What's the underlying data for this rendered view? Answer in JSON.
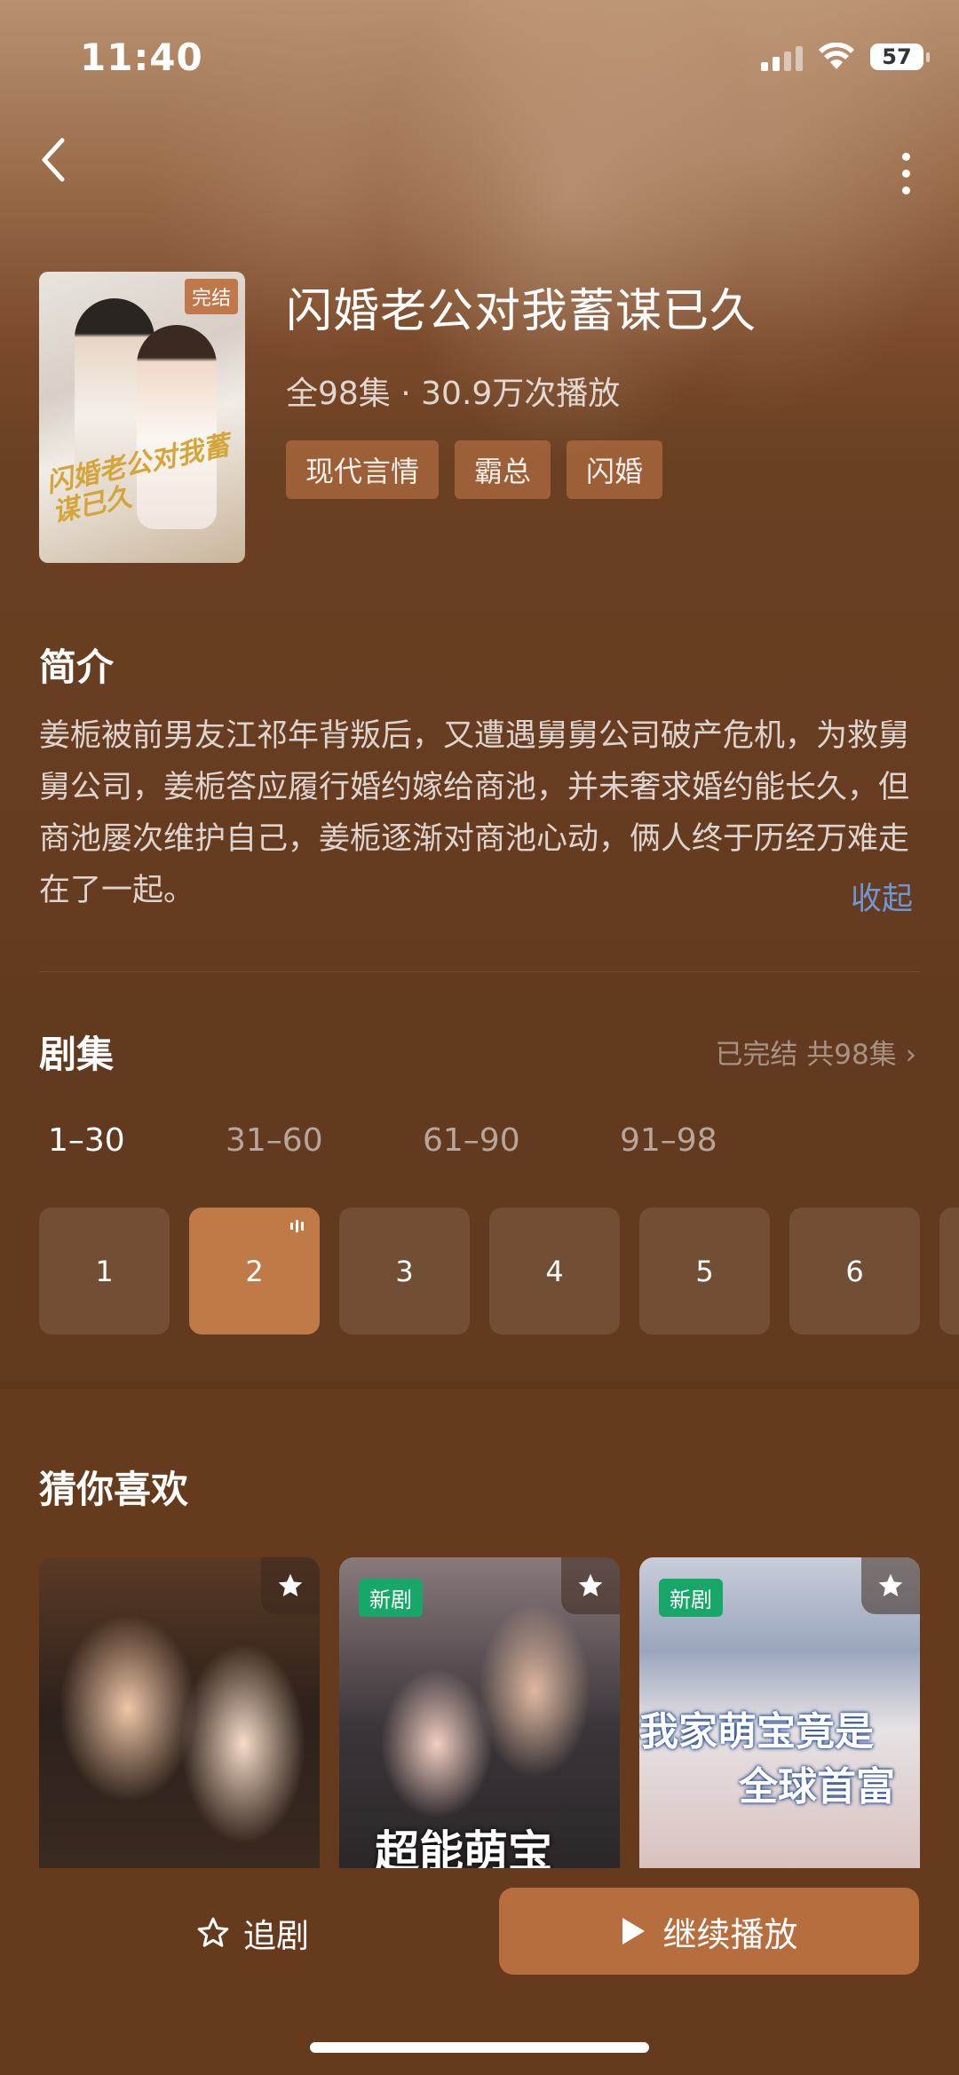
{
  "status_bar": {
    "time": "11:40",
    "battery": "57"
  },
  "drama": {
    "status_badge": "完结",
    "poster_text": "闪婚老公对我蓄谋已久",
    "title": "闪婚老公对我蓄谋已久",
    "meta": "全98集 · 30.9万次播放",
    "tags": [
      "现代言情",
      "霸总",
      "闪婚"
    ]
  },
  "intro": {
    "heading": "简介",
    "text": "姜栀被前男友江祁年背叛后，又遭遇舅舅公司破产危机，为救舅舅公司，姜栀答应履行婚约嫁给商池，并未奢求婚约能长久，但商池屡次维护自己，姜栀逐渐对商池心动，俩人终于历经万难走在了一起。",
    "collapse_label": "收起"
  },
  "episodes": {
    "heading": "剧集",
    "summary": "已完结 共98集 ›",
    "ranges": [
      "1–30",
      "31–60",
      "61–90",
      "91–98"
    ],
    "active_range": 0,
    "items": [
      "1",
      "2",
      "3",
      "4",
      "5",
      "6"
    ],
    "current": 1
  },
  "recommend": {
    "heading": "猜你喜欢",
    "cards": [
      {
        "badge": "",
        "title_text": ""
      },
      {
        "badge": "新剧",
        "title_text": "超能萌宝"
      },
      {
        "badge": "新剧",
        "title_text": "我家萌宝竟是全球首富"
      }
    ],
    "card3_line1": "我家萌宝竟是",
    "card3_line2": "全球首富"
  },
  "bottom_bar": {
    "follow_label": "追剧",
    "play_label": "继续播放"
  },
  "colors": {
    "accent": "#b66e3f",
    "link": "#6f97d6",
    "new_badge": "#17a869",
    "background": "#653a1d"
  }
}
